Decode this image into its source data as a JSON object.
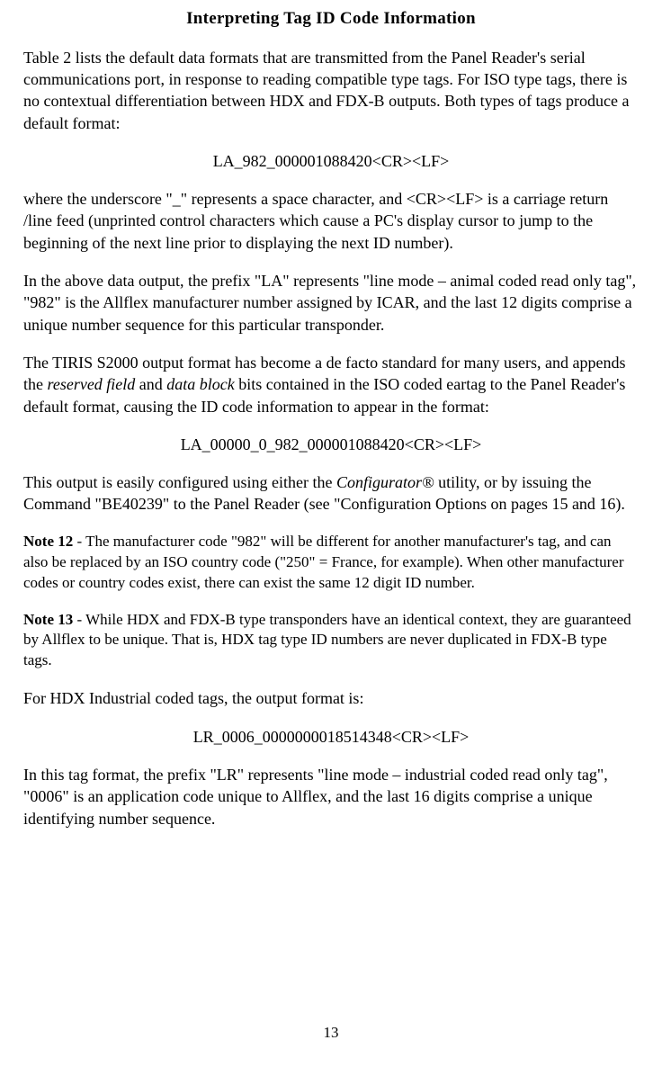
{
  "title": "Interpreting Tag ID Code Information",
  "p1": "Table 2 lists the default data formats that are transmitted from the Panel Reader's serial communications port, in response to reading compatible type tags.  For ISO type tags, there is no contextual differentiation between HDX and FDX-B outputs.  Both types of tags produce a default format:",
  "code1": "LA_982_000001088420<CR><LF>",
  "p2": "where the underscore \"_\" represents a space character, and <CR><LF> is a carriage return /line feed (unprinted control characters which cause a PC's display cursor to jump to the beginning of the next line prior to displaying the next ID number).",
  "p3": "In the above data output, the prefix \"LA\" represents \"line mode – animal coded read only tag\", \"982\" is the Allflex manufacturer number assigned by ICAR, and the last 12 digits comprise a unique number sequence for this particular transponder.",
  "p4_a": "The TIRIS S2000 output format has become a de facto standard for many users, and appends the ",
  "p4_i1": "reserved field",
  "p4_b": " and ",
  "p4_i2": "data block",
  "p4_c": " bits contained in the ISO coded eartag to the Panel Reader's default format, causing the ID code information to appear in the format:",
  "code2": "LA_00000_0_982_000001088420<CR><LF>",
  "p5_a": "This output is easily configured using either the ",
  "p5_i": "Configurator®",
  "p5_b": " utility, or by issuing the Command \"BE40239\" to the Panel Reader  (see \"Configuration Options on pages 15 and 16).",
  "note12_label": "Note 12",
  "note12_body": "  -  The manufacturer code \"982\" will be different for another manufacturer's tag, and can also be replaced by an ISO country code (\"250\" = France, for example).  When other manufacturer codes or country codes exist, there can exist the same 12 digit ID number.",
  "note13_label": "Note 13",
  "note13_body": "  -  While HDX and FDX-B type transponders have an identical context, they are guaranteed by Allflex to be unique.  That is, HDX tag type ID numbers are never duplicated in FDX-B type tags.",
  "p6": "For HDX Industrial coded tags, the output format is:",
  "code3": "LR_0006_0000000018514348<CR><LF>",
  "p7": "In this tag format, the prefix \"LR\" represents \"line mode – industrial coded read only tag\", \"0006\" is an application code unique to Allflex, and the last 16 digits comprise a unique identifying number sequence.",
  "page_number": "13"
}
